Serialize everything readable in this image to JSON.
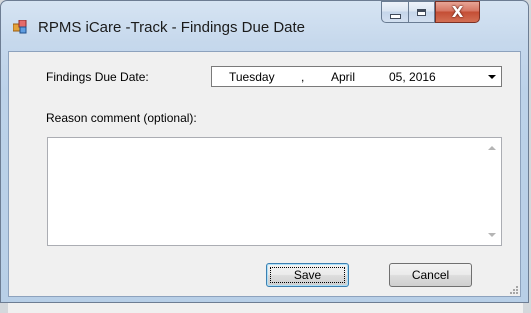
{
  "window": {
    "title": "RPMS iCare -Track - Findings Due Date",
    "icon": "app-icon",
    "controls": {
      "minimize": "minimize-icon",
      "maximize": "maximize-icon",
      "close_glyph": "X"
    }
  },
  "form": {
    "due_date_label": "Findings Due Date:",
    "due_date": {
      "weekday": "Tuesday",
      "separator": ",",
      "month": "April",
      "day_year": "05, 2016"
    },
    "reason_label": "Reason comment (optional):",
    "reason_value": ""
  },
  "buttons": {
    "save": "Save",
    "cancel": "Cancel"
  },
  "colors": {
    "title_bar": "#b8cfe7",
    "close_button": "#c44e35",
    "dialog_bg": "#f0f0f0"
  }
}
